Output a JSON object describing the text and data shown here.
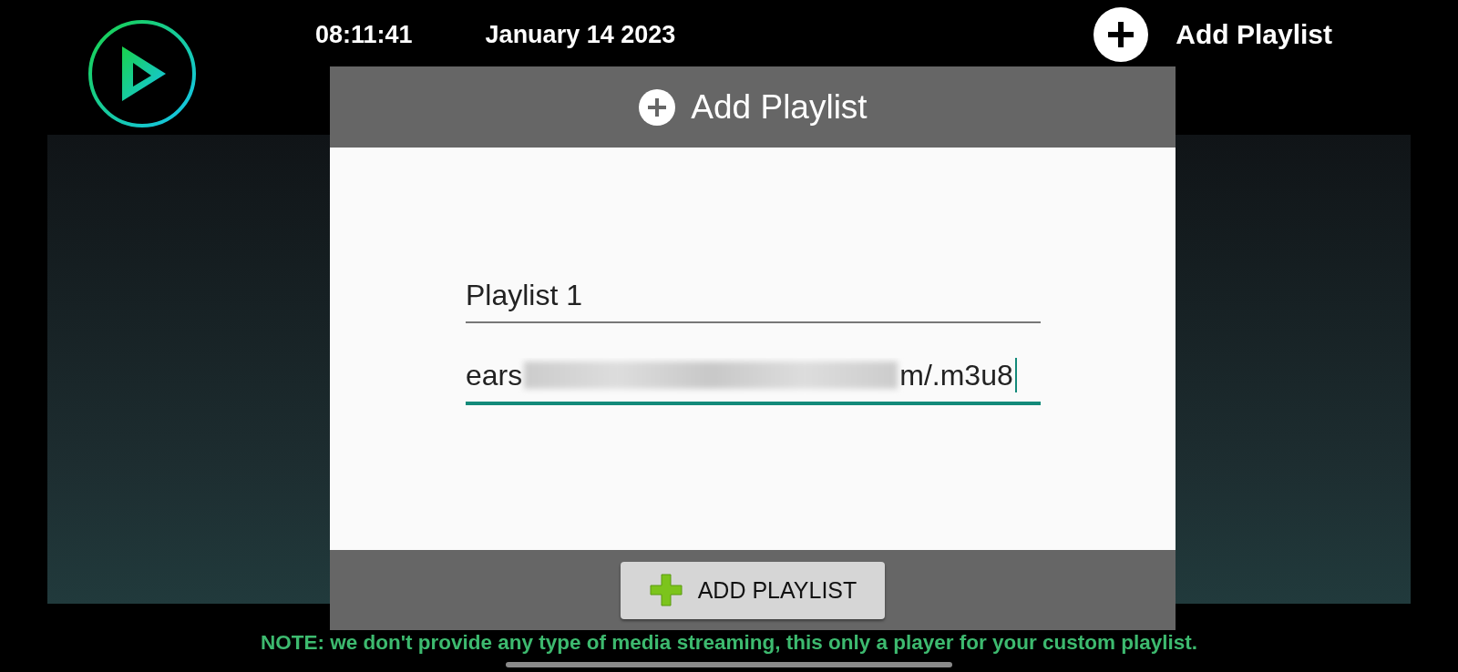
{
  "header": {
    "time": "08:11:41",
    "date": "January 14 2023",
    "add_button": "Add Playlist"
  },
  "dialog": {
    "title": "Add Playlist",
    "fields": [
      {
        "kind": "plain",
        "value": "Playlist 1",
        "focused": false
      },
      {
        "kind": "redacted",
        "value_start": "ears",
        "value_end": "m/.m3u8",
        "focused": true
      }
    ],
    "button": "ADD PLAYLIST"
  },
  "note": "NOTE: we don't provide any type of media streaming, this only a player for your custom playlist."
}
